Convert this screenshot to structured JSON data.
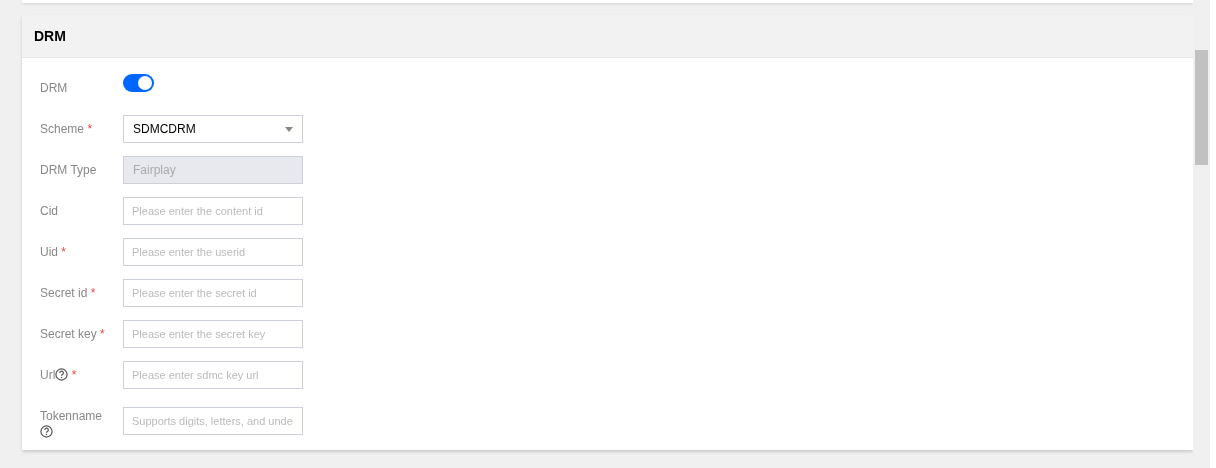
{
  "section": {
    "title": "DRM"
  },
  "fields": [
    {
      "kind": "toggle",
      "label": "DRM",
      "help": false,
      "on": true
    },
    {
      "kind": "select",
      "label": "Scheme",
      "required_mark": "*",
      "help": false,
      "value": "SDMCDRM"
    },
    {
      "kind": "disabled",
      "label": "DRM Type",
      "help": false,
      "value": "Fairplay"
    },
    {
      "kind": "input",
      "label": "Cid",
      "help": false,
      "placeholder": "Please enter the content id"
    },
    {
      "kind": "input",
      "label": "Uid",
      "required_mark": "*",
      "help": false,
      "placeholder": "Please enter the userid"
    },
    {
      "kind": "input",
      "label": "Secret id",
      "required_mark": "*",
      "help": false,
      "placeholder": "Please enter the secret id"
    },
    {
      "kind": "input",
      "label": "Secret key",
      "required_mark": "*",
      "help": false,
      "placeholder": "Please enter the secret key"
    },
    {
      "kind": "input",
      "label": "Url",
      "required_mark": "*",
      "help": true,
      "placeholder": "Please enter sdmc key url"
    },
    {
      "kind": "input",
      "label": "Tokenname",
      "help": true,
      "placeholder": "Supports digits, letters, and unde"
    }
  ]
}
